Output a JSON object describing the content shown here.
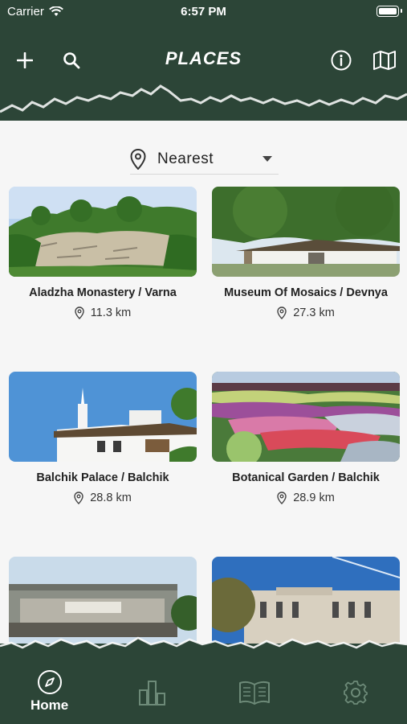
{
  "status": {
    "carrier": "Carrier",
    "time": "6:57 PM"
  },
  "header": {
    "title": "PLACES",
    "icons": [
      "plus-icon",
      "search-icon",
      "info-icon",
      "map-icon"
    ]
  },
  "sort": {
    "selected": "Nearest"
  },
  "places": [
    {
      "name": "Aladzha Monastery / Varna",
      "distance": "11.3 km"
    },
    {
      "name": "Museum Of Mosaics  / Devnya",
      "distance": "27.3 km"
    },
    {
      "name": "Balchik Palace / Balchik",
      "distance": "28.8 km"
    },
    {
      "name": "Botanical Garden / Balchik",
      "distance": "28.9 km"
    },
    {
      "name": "",
      "distance": ""
    },
    {
      "name": "",
      "distance": ""
    }
  ],
  "tabbar": {
    "tabs": [
      {
        "label": "Home",
        "icon": "compass-icon",
        "active": true
      },
      {
        "label": "",
        "icon": "chart-icon",
        "active": false
      },
      {
        "label": "",
        "icon": "book-icon",
        "active": false
      },
      {
        "label": "",
        "icon": "gear-icon",
        "active": false
      }
    ]
  },
  "colors": {
    "brand": "#2c4537",
    "background": "#f6f6f6"
  }
}
